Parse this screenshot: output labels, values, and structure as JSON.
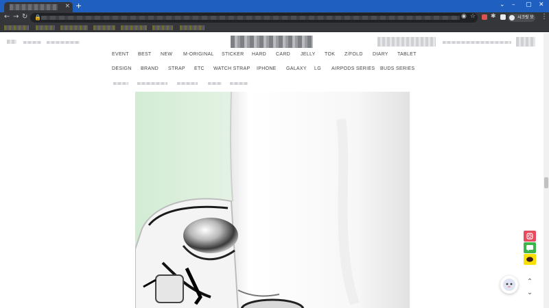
{
  "browser": {
    "tab_close": "×",
    "new_tab": "+",
    "window_controls": [
      "⌄",
      "–",
      "▢",
      "✕"
    ],
    "nav": {
      "back": "←",
      "forward": "→",
      "reload": "↻"
    },
    "omnibox_icons": [
      "eye-off-icon",
      "star-icon"
    ],
    "profile_label": "시크릿 모드",
    "menu": "⋮",
    "accent_color": "#1f5fbf"
  },
  "categories": {
    "row1": [
      "EVENT",
      "BEST",
      "NEW",
      "M-ORIGINAL",
      "STICKER",
      "HARD",
      "CARD",
      "JELLY",
      "TOK",
      "Z/FOLD",
      "DIARY",
      "TABLET"
    ],
    "row2": [
      "DESIGN",
      "BRAND",
      "STRAP",
      "ETC",
      "WATCH STRAP",
      "IPHONE",
      "GALAXY",
      "LG",
      "AIRPODS SERIES",
      "BUDS SERIES"
    ]
  },
  "side_actions": {
    "colors": {
      "instagram": "#e84a5f",
      "chat": "#3db54a",
      "kakao": "#f9e000"
    }
  },
  "scroll_controls": {
    "up": "⌃",
    "down": "⌄"
  }
}
